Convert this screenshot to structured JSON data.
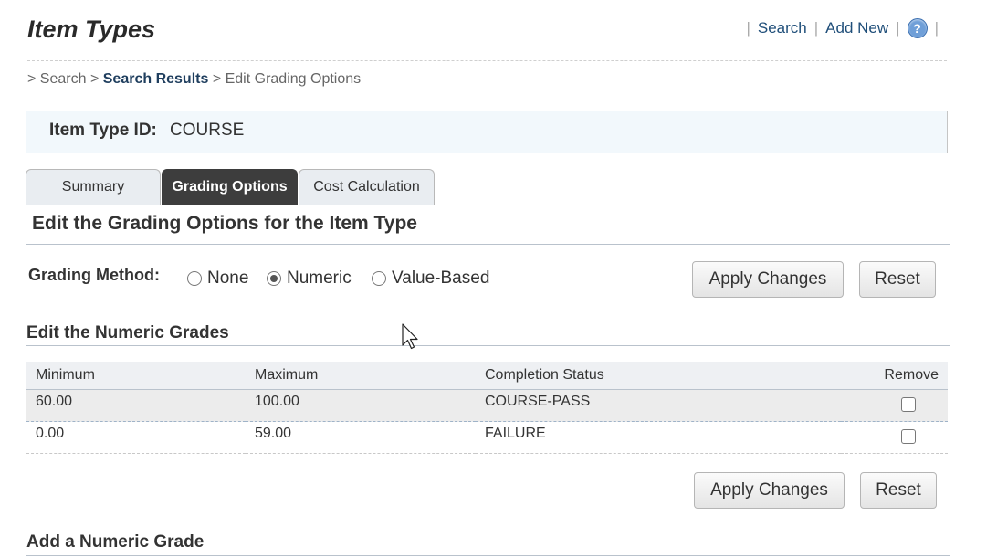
{
  "header": {
    "title": "Item Types",
    "links": [
      {
        "label": "Search"
      },
      {
        "label": "Add New"
      }
    ],
    "help_icon": "help-icon",
    "separator": "|"
  },
  "breadcrumb": {
    "prefix": ">",
    "search": "Search",
    "sep": ">",
    "results": "Search Results",
    "current": "Edit Grading Options"
  },
  "item": {
    "id_label": "Item Type ID:",
    "id_value": "COURSE"
  },
  "tabs": [
    {
      "label": "Summary",
      "active": false
    },
    {
      "label": "Grading Options",
      "active": true
    },
    {
      "label": "Cost Calculation",
      "active": false
    }
  ],
  "main": {
    "section_title": "Edit the Grading Options for the Item Type",
    "grading_method_label": "Grading Method:",
    "grading_options": [
      {
        "label": "None",
        "selected": false
      },
      {
        "label": "Numeric",
        "selected": true
      },
      {
        "label": "Value-Based",
        "selected": false
      }
    ],
    "apply_label": "Apply Changes",
    "reset_label": "Reset",
    "numeric_title": "Edit the Numeric Grades",
    "add_title": "Add a Numeric Grade"
  },
  "grades_table": {
    "columns": [
      "Minimum",
      "Maximum",
      "Completion Status",
      "Remove"
    ],
    "rows": [
      {
        "min": "60.00",
        "max": "100.00",
        "status": "COURSE-PASS",
        "remove": false
      },
      {
        "min": "0.00",
        "max": "59.00",
        "status": "FAILURE",
        "remove": false
      }
    ]
  },
  "colors": {
    "active_tab": "#3d3d3d",
    "link": "#1f4e79",
    "id_box_bg": "#f2f8fc"
  }
}
